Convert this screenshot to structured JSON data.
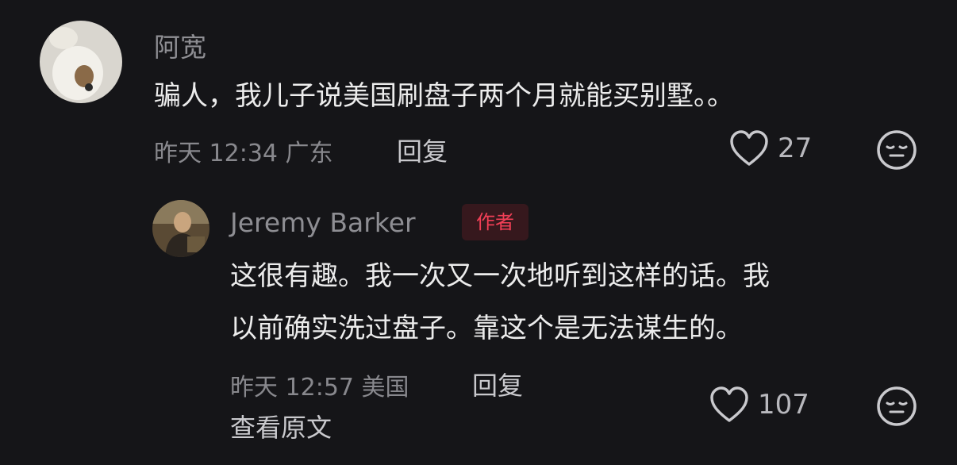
{
  "comment": {
    "user": {
      "name": "阿宽",
      "avatar": "cat-photo-avatar"
    },
    "text": "骗人，我儿子说美国刷盘子两个月就能买别墅。。",
    "meta": "昨天 12:34 广东",
    "reply_label": "回复",
    "likes": "27",
    "icons": {
      "like": "heart-icon",
      "react": "face-emoji-icon"
    }
  },
  "reply": {
    "user": {
      "name": "Jeremy Barker",
      "avatar": "man-photo-avatar"
    },
    "badge": "作者",
    "text_lines": [
      "这很有趣。我一次又一次地听到这样的话。我",
      "以前确实洗过盘子。靠这个是无法谋生的。"
    ],
    "meta": "昨天 12:57 美国",
    "reply_label": "回复",
    "view_original": "查看原文",
    "likes": "107",
    "icons": {
      "like": "heart-icon",
      "react": "face-emoji-icon"
    }
  },
  "colors": {
    "background": "#151518",
    "badge_text": "#f13f56",
    "badge_bg": "#36181d",
    "meta": "#88888d"
  }
}
